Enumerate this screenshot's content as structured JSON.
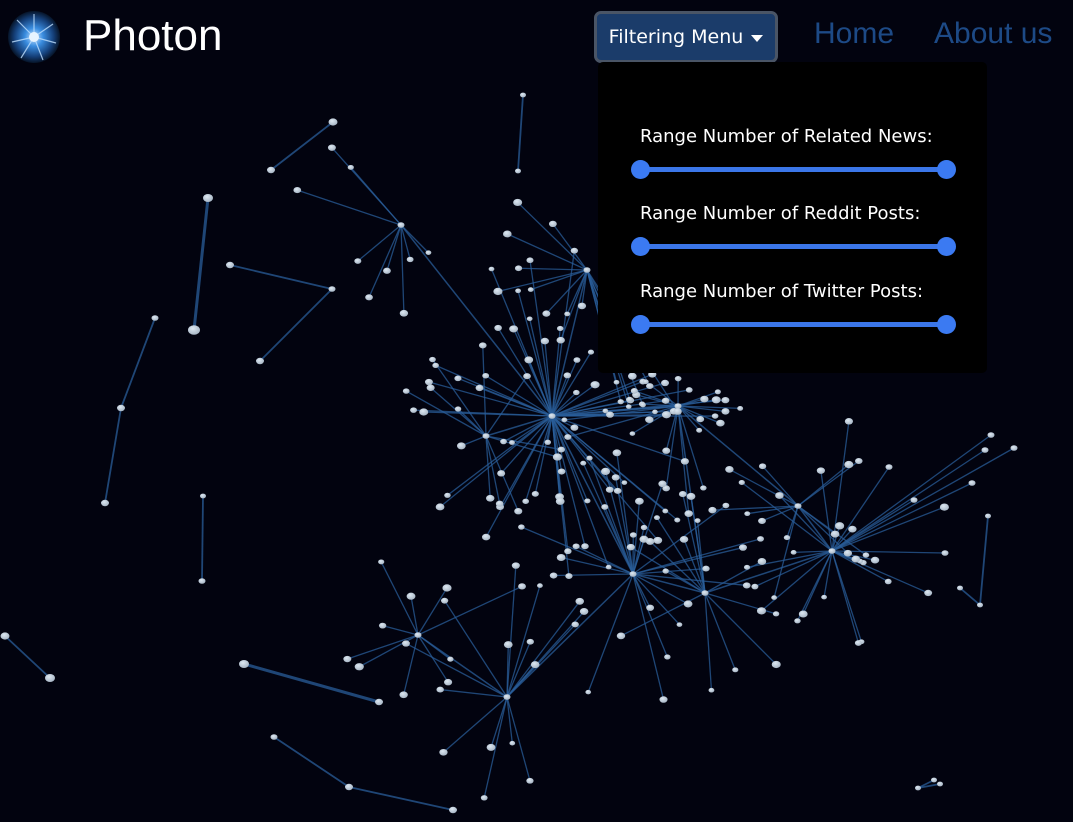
{
  "navbar": {
    "brand": "Photon",
    "filter_button": "Filtering Menu",
    "links": [
      "Home",
      "About us"
    ]
  },
  "filter_menu": {
    "ranges": [
      {
        "label": "Range Number of Related News:",
        "min_fraction": 0,
        "max_fraction": 1
      },
      {
        "label": "Range Number of Reddit Posts:",
        "min_fraction": 0,
        "max_fraction": 1
      },
      {
        "label": "Range Number of Twitter Posts:",
        "min_fraction": 0,
        "max_fraction": 1
      }
    ]
  },
  "colors": {
    "background": "#02030f",
    "node": "#a9b7c6",
    "edge": "#2a5d9a",
    "slider": "#3b7af2",
    "button": "#1b3c6a",
    "link": "#1d4a86"
  },
  "icons": {
    "logo": "photon-burst-icon",
    "caret": "caret-down-icon"
  }
}
